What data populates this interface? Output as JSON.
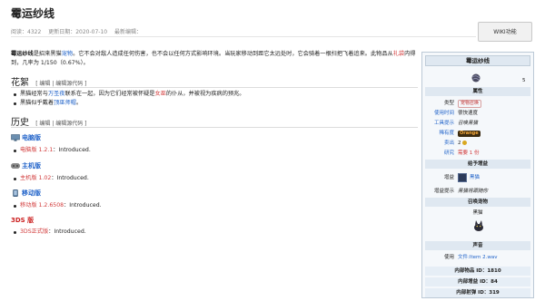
{
  "page": {
    "title": "霉运纱线",
    "meta": {
      "views": "阅读：4322",
      "updated": "更新日期：2020-07-10",
      "editor": "最新编辑："
    },
    "wiki_button": "WIKI功能",
    "intro_parts": [
      "霉运纱线",
      "是招来黑猫",
      "宠物",
      "。它不会对敌人造成任何伤害，也不会以任何方式影响环境。当玩家移动到距它太远处时，它会骑着一根扫把飞着追来。此物品从",
      "礼袋",
      "内得到，几率为 1/150（0.67%）。"
    ]
  },
  "sections": {
    "trivia": {
      "heading": "花絮",
      "edit": "[ 编辑 | 编辑源代码 ]",
      "items": [
        [
          "黑猫经常与",
          "万圣夜",
          "联系在一起，因为它们经常被怀疑是",
          "女巫",
          "的仆从，并被视为疾病的预兆。"
        ],
        [
          "黑猫似乎戴着",
          "顶巫师帽",
          "。"
        ]
      ]
    },
    "history": {
      "heading": "历史",
      "edit": "[ 编辑 | 编辑源代码 ]",
      "platforms": [
        {
          "name": "电脑版",
          "version": "电脑版 1.2.1",
          "note": "：Introduced."
        },
        {
          "name": "主机版",
          "version": "主机版 1.02",
          "note": "：Introduced."
        },
        {
          "name": "移动版",
          "version": "移动版 1.2.6508",
          "note": "：Introduced."
        },
        {
          "name": "3DS 版",
          "version": "3DS正式版",
          "note": "：Introduced."
        }
      ]
    }
  },
  "infobox": {
    "title": "霉运纱线",
    "stack": "5",
    "headers": {
      "props": "属性",
      "pet": "给予增益",
      "summon": "召唤宠物",
      "sound": "声音"
    },
    "rows": {
      "type_k": "类型",
      "type_v": "宠物召唤",
      "use_k": "使用时间",
      "use_v": "很快速度",
      "tip_k": "工具提示",
      "tip_v": "召唤黑猫",
      "rarity_k": "稀有度",
      "rarity_v": "Orange",
      "sell_k": "卖出",
      "sell_v": "2",
      "research_k": "研究",
      "research_v": "需要 1 份",
      "buff_k": "增益",
      "buff_v": "黑猫",
      "bufftip_k": "增益提示",
      "bufftip_v": "黑猫将跟随你",
      "summon_v": "黑猫",
      "sound_k": "使用",
      "sound_v": "文件:Item 2.wav"
    },
    "ids": [
      "内部物品 ID：1810",
      "内部增益 ID：84",
      "内部射弹 ID：319"
    ]
  },
  "colors": {
    "link": "#1f62c9",
    "red": "#d23b3b",
    "infobox_bg": "#f5f8fb",
    "header_bg": "#dfe8f1"
  }
}
